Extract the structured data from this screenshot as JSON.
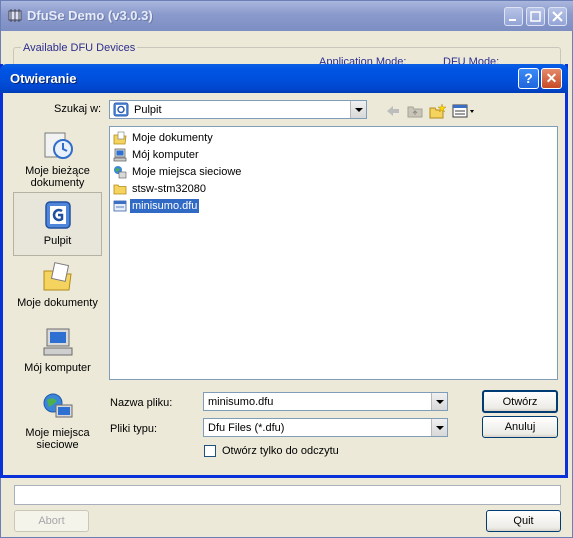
{
  "app": {
    "title": "DfuSe Demo (v3.0.3)",
    "group_label": "Available DFU Devices",
    "application_mode_label": "Application Mode:",
    "dfu_mode_label": "DFU Mode:",
    "abort_label": "Abort",
    "quit_label": "Quit"
  },
  "dialog": {
    "title": "Otwieranie",
    "look_in_label": "Szukaj w:",
    "look_in_value": "Pulpit",
    "places": [
      {
        "label": "Moje bieżące dokumenty",
        "icon": "recent-documents-icon"
      },
      {
        "label": "Pulpit",
        "icon": "desktop-icon"
      },
      {
        "label": "Moje dokumenty",
        "icon": "my-documents-icon"
      },
      {
        "label": "Mój komputer",
        "icon": "my-computer-icon"
      },
      {
        "label": "Moje miejsca sieciowe",
        "icon": "network-places-icon"
      }
    ],
    "files": [
      {
        "name": "Moje dokumenty",
        "icon": "my-documents-icon",
        "selected": false
      },
      {
        "name": "Mój komputer",
        "icon": "my-computer-icon",
        "selected": false
      },
      {
        "name": "Moje miejsca sieciowe",
        "icon": "network-places-icon",
        "selected": false
      },
      {
        "name": "stsw-stm32080",
        "icon": "folder-icon",
        "selected": false
      },
      {
        "name": "minisumo.dfu",
        "icon": "dfu-file-icon",
        "selected": true
      }
    ],
    "filename_label": "Nazwa pliku:",
    "filename_value": "minisumo.dfu",
    "filetype_label": "Pliki typu:",
    "filetype_value": "Dfu Files (*.dfu)",
    "readonly_label": "Otwórz tylko do odczytu",
    "open_label": "Otwórz",
    "cancel_label": "Anuluj",
    "help_glyph": "?",
    "close_glyph": "✕"
  },
  "colors": {
    "xp_blue": "#0054E3",
    "selection": "#316AC5",
    "dialog_bg": "#ECE9D8"
  }
}
